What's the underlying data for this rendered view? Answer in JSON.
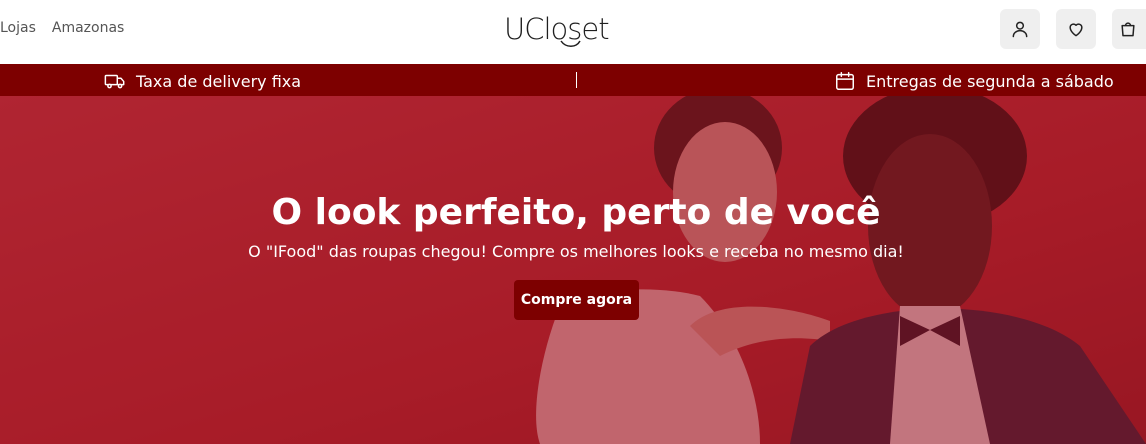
{
  "header": {
    "nav": [
      {
        "label": "Lojas"
      },
      {
        "label": "Amazonas"
      }
    ],
    "logo_text": "UCloset",
    "icons": [
      "user-icon",
      "heart-icon",
      "shopping-bag-icon"
    ]
  },
  "promo": {
    "left": {
      "icon": "delivery-truck-icon",
      "label": "Taxa de delivery fixa"
    },
    "right": {
      "icon": "calendar-icon",
      "label": "Entregas de segunda a sábado"
    }
  },
  "hero": {
    "title": "O look perfeito, perto de você",
    "subtitle": "O \"IFood\" das roupas chegou! Compre os melhores looks e receba no mesmo dia!",
    "cta_label": "Compre agora"
  },
  "colors": {
    "brand": "#7d0000",
    "hero_tint": "#a3202a",
    "icon_bg": "#efefef"
  }
}
